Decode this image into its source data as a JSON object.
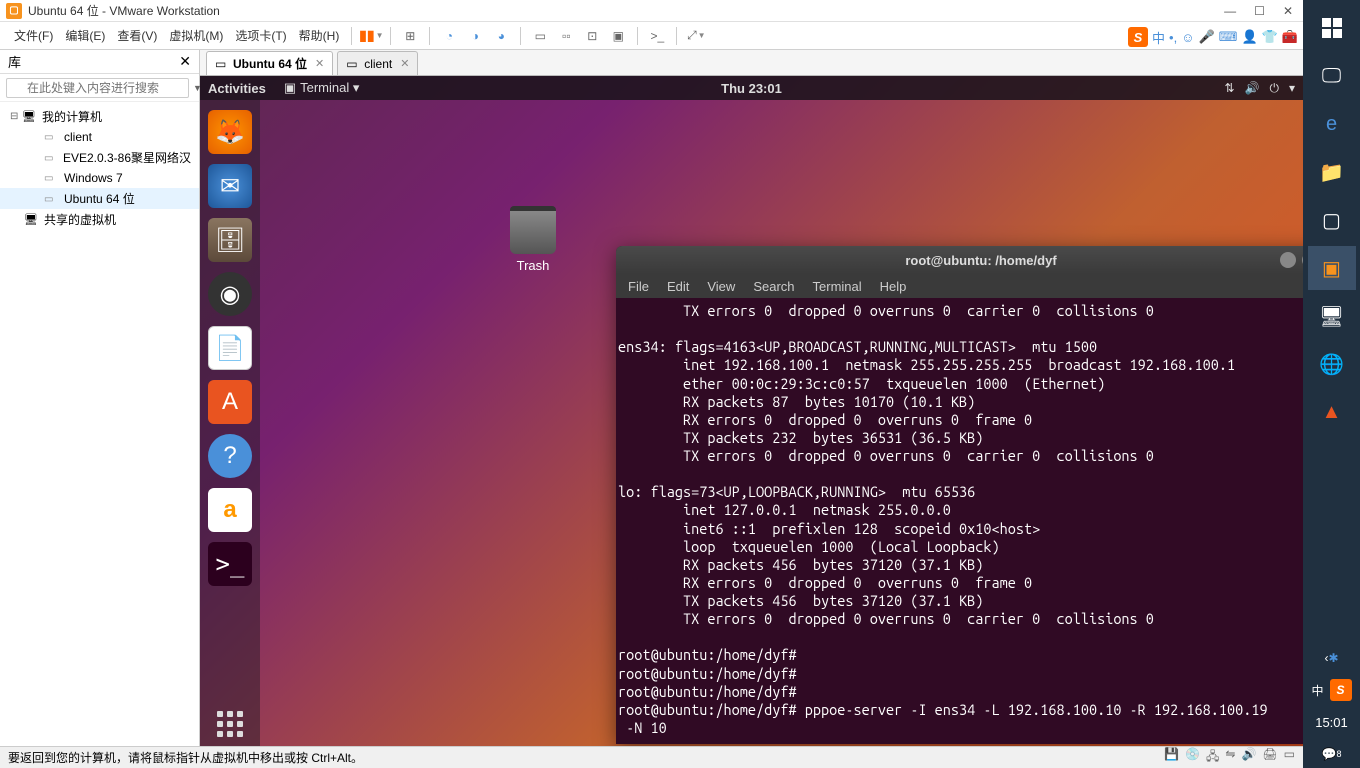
{
  "titlebar": {
    "title": "Ubuntu 64 位 - VMware Workstation"
  },
  "menubar": {
    "file": "文件(F)",
    "edit": "编辑(E)",
    "view": "查看(V)",
    "vm": "虚拟机(M)",
    "tabs": "选项卡(T)",
    "help": "帮助(H)"
  },
  "ime": {
    "lang": "中",
    "comma": "', ,",
    "smile": "☺"
  },
  "library": {
    "title": "库",
    "search_placeholder": "在此处键入内容进行搜索",
    "root": "我的计算机",
    "items": [
      "client",
      "EVE2.0.3-86聚星网络汉",
      "Windows 7",
      "Ubuntu 64 位"
    ],
    "shared": "共享的虚拟机"
  },
  "tabs": [
    {
      "label": "Ubuntu 64 位",
      "active": true
    },
    {
      "label": "client",
      "active": false
    }
  ],
  "ubuntu": {
    "activities": "Activities",
    "termmenu": "Terminal ▾",
    "clock": "Thu 23:01",
    "trash": "Trash"
  },
  "terminal": {
    "title": "root@ubuntu: /home/dyf",
    "menu": {
      "file": "File",
      "edit": "Edit",
      "view": "View",
      "search": "Search",
      "terminal": "Terminal",
      "help": "Help"
    },
    "lines": [
      "        TX errors 0  dropped 0 overruns 0  carrier 0  collisions 0",
      "",
      "ens34: flags=4163<UP,BROADCAST,RUNNING,MULTICAST>  mtu 1500",
      "        inet 192.168.100.1  netmask 255.255.255.255  broadcast 192.168.100.1",
      "        ether 00:0c:29:3c:c0:57  txqueuelen 1000  (Ethernet)",
      "        RX packets 87  bytes 10170 (10.1 KB)",
      "        RX errors 0  dropped 0  overruns 0  frame 0",
      "        TX packets 232  bytes 36531 (36.5 KB)",
      "        TX errors 0  dropped 0 overruns 0  carrier 0  collisions 0",
      "",
      "lo: flags=73<UP,LOOPBACK,RUNNING>  mtu 65536",
      "        inet 127.0.0.1  netmask 255.0.0.0",
      "        inet6 ::1  prefixlen 128  scopeid 0x10<host>",
      "        loop  txqueuelen 1000  (Local Loopback)",
      "        RX packets 456  bytes 37120 (37.1 KB)",
      "        RX errors 0  dropped 0  overruns 0  frame 0",
      "        TX packets 456  bytes 37120 (37.1 KB)",
      "        TX errors 0  dropped 0 overruns 0  carrier 0  collisions 0",
      "",
      "root@ubuntu:/home/dyf#",
      "root@ubuntu:/home/dyf#",
      "root@ubuntu:/home/dyf#",
      "root@ubuntu:/home/dyf# pppoe-server -I ens34 -L 192.168.100.10 -R 192.168.100.19",
      " -N 10"
    ]
  },
  "statusbar": {
    "msg": "要返回到您的计算机，请将鼠标指针从虚拟机中移出或按 Ctrl+Alt。"
  },
  "wintb": {
    "clock": "15:01",
    "lang": "中",
    "notif": "8"
  }
}
